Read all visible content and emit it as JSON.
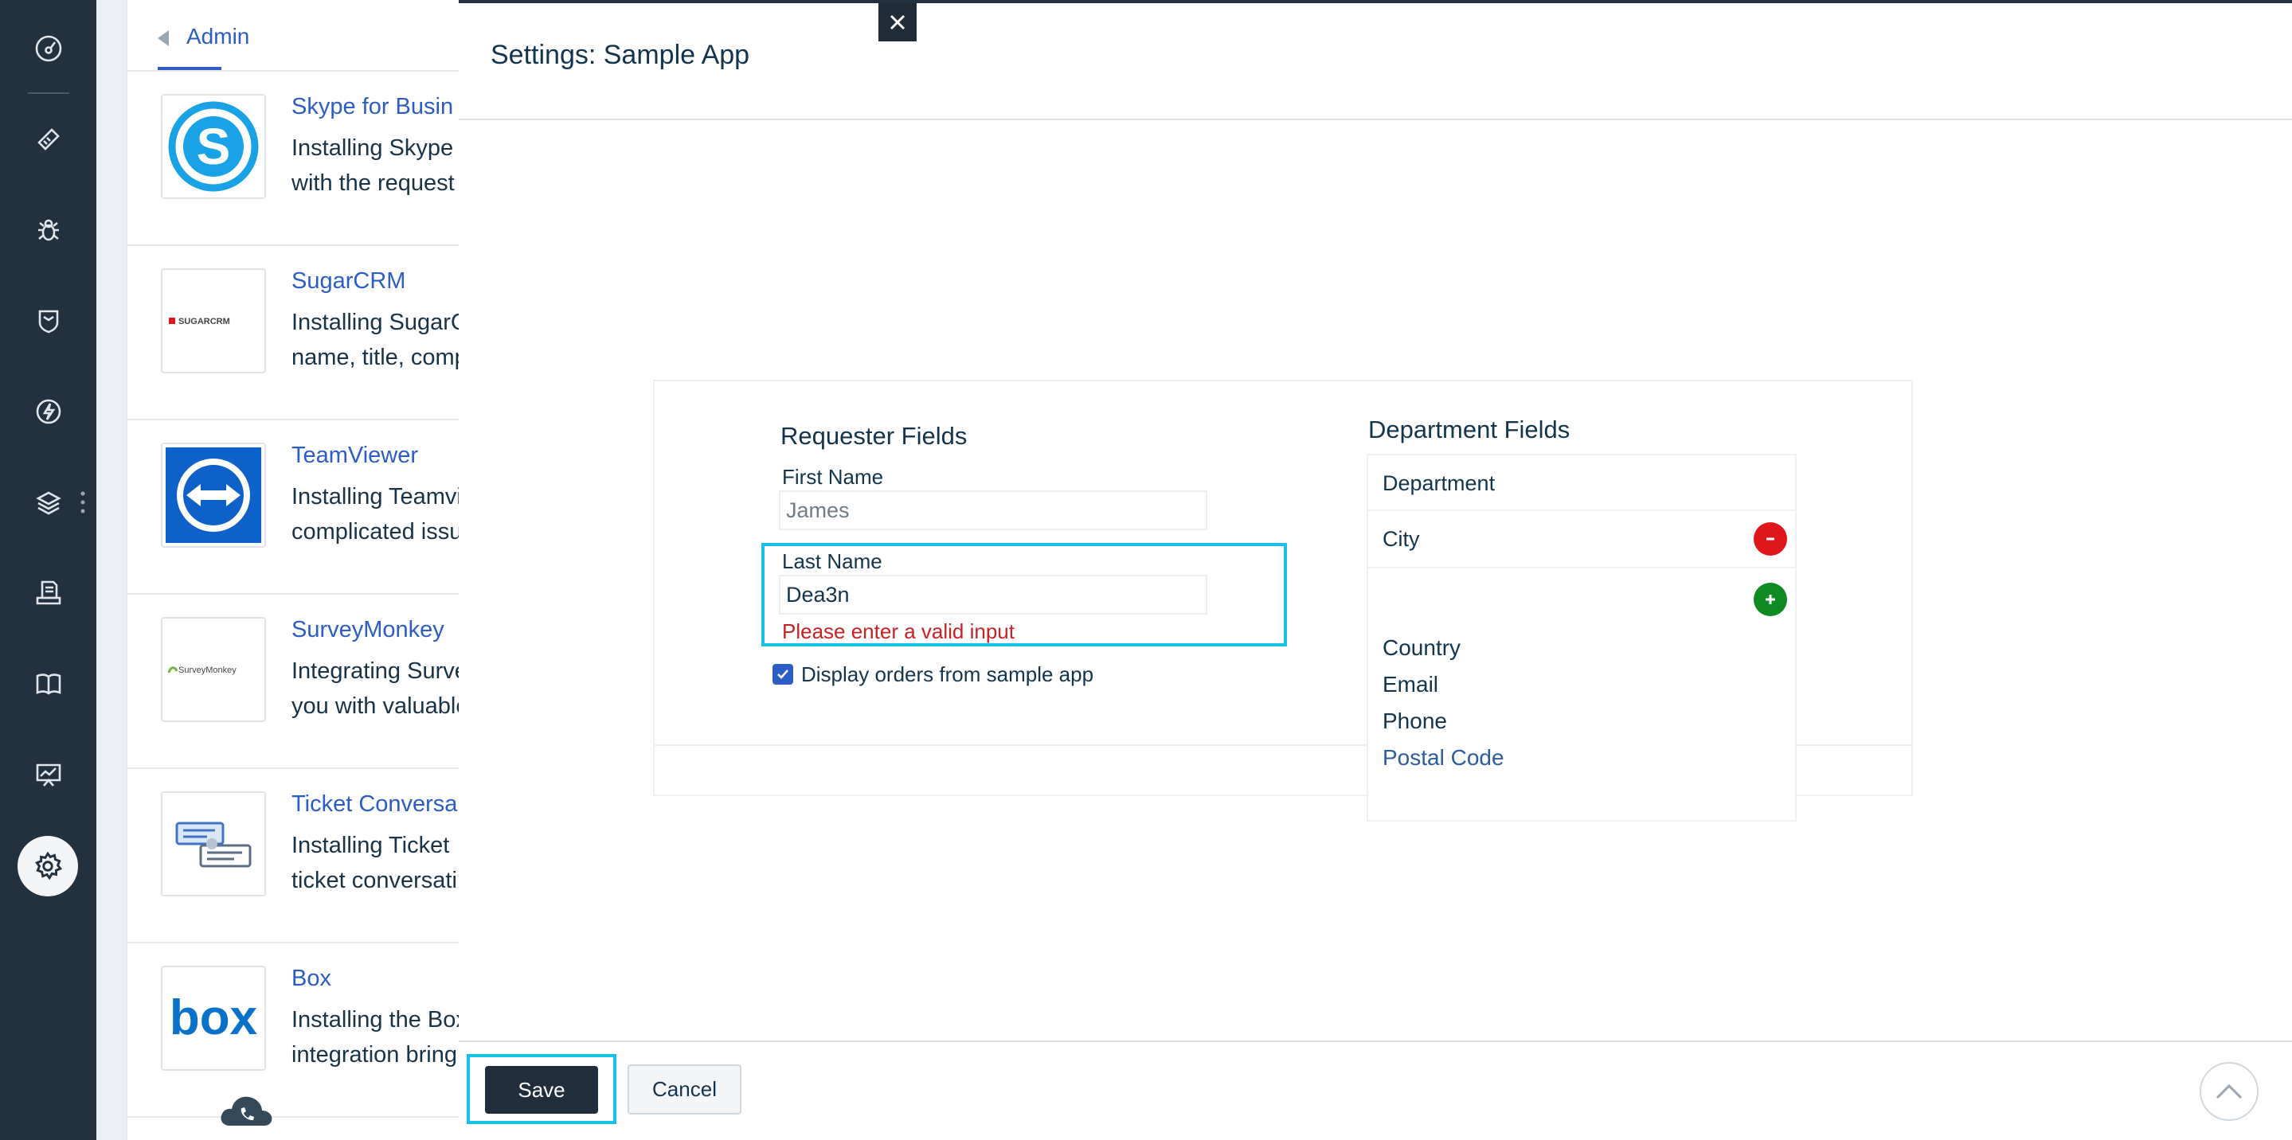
{
  "admin": {
    "breadcrumb": "Admin",
    "apps": [
      {
        "name": "Skype for Busin",
        "desc_line1": "Installing Skype",
        "desc_line2": "with the request",
        "logo": "skype-logo"
      },
      {
        "name": "SugarCRM",
        "desc_line1": "Installing SugarC",
        "desc_line2": "name, title, comp",
        "logo": "sugarcrm-logo",
        "logo_text": "SUGARCRM"
      },
      {
        "name": "TeamViewer",
        "desc_line1": "Installing Teamvi",
        "desc_line2": "complicated issu",
        "logo": "teamviewer-logo"
      },
      {
        "name": "SurveyMonkey",
        "desc_line1": "Integrating Surve",
        "desc_line2": "you with valuable",
        "logo": "surveymonkey-logo",
        "logo_text": "SurveyMonkey"
      },
      {
        "name": "Ticket Conversa",
        "desc_line1": "Installing Ticket",
        "desc_line2": "ticket conversati",
        "logo": "ticket-conversation-logo"
      },
      {
        "name": "Box",
        "desc_line1": "Installing the Box",
        "desc_line2": "integration bring",
        "logo": "box-logo",
        "logo_text": "box"
      }
    ]
  },
  "modal": {
    "title": "Settings: Sample App",
    "close_icon": "close-icon",
    "requester": {
      "title": "Requester Fields",
      "first_name_label": "First Name",
      "first_name_value": "James",
      "last_name_label": "Last Name",
      "last_name_value": "Dea3n",
      "error": "Please enter a valid input",
      "checkbox_label": "Display orders from sample app",
      "checkbox_checked": true
    },
    "department": {
      "title": "Department Fields",
      "header": "Department",
      "selected_row": "City",
      "options": [
        "Country",
        "Email",
        "Phone",
        "Postal Code"
      ],
      "highlighted_option": "Postal Code"
    },
    "footer": {
      "save_label": "Save",
      "cancel_label": "Cancel"
    }
  },
  "rail": {
    "icons": [
      "dashboard-icon",
      "tickets-icon",
      "problems-icon",
      "changes-icon",
      "releases-icon",
      "assets-icon",
      "contracts-icon",
      "solutions-icon",
      "analytics-icon",
      "admin-settings-icon"
    ]
  },
  "colors": {
    "rail_bg": "#21313f",
    "link_blue": "#2c5cc5",
    "highlight_cyan": "#18c0ea",
    "error_red": "#c82124",
    "remove_red": "#e0161d",
    "add_green": "#0f8a22",
    "primary_btn": "#1f2d3d"
  }
}
